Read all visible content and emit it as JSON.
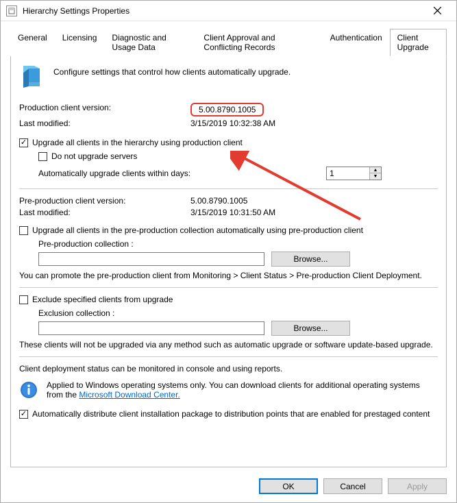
{
  "window": {
    "title": "Hierarchy Settings Properties"
  },
  "tabs": {
    "general": "General",
    "licensing": "Licensing",
    "diagnostic": "Diagnostic and Usage Data",
    "client_approval": "Client Approval and Conflicting Records",
    "authentication": "Authentication",
    "client_upgrade": "Client Upgrade"
  },
  "intro": "Configure settings that control how clients automatically upgrade.",
  "prod": {
    "version_label": "Production client version:",
    "version_value": "5.00.8790.1005",
    "modified_label": "Last modified:",
    "modified_value": "3/15/2019 10:32:38 AM"
  },
  "upgrade_hierarchy": "Upgrade all clients in the hierarchy using production client",
  "no_servers": "Do not upgrade servers",
  "auto_days_label": "Automatically upgrade clients within days:",
  "auto_days_value": "1",
  "preprod": {
    "version_label": "Pre-production client version:",
    "version_value": "5.00.8790.1005",
    "modified_label": "Last modified:",
    "modified_value": "3/15/2019 10:31:50 AM"
  },
  "upgrade_preprod": "Upgrade all clients in the pre-production collection automatically using pre-production client",
  "preprod_collection_label": "Pre-production collection :",
  "browse": "Browse...",
  "promote_note": "You can promote the pre-production client from Monitoring > Client Status > Pre-production Client Deployment.",
  "exclude": "Exclude specified clients from upgrade",
  "exclusion_label": "Exclusion collection :",
  "exclude_note": "These clients will not be upgraded via any method such as automatic upgrade or software update-based upgrade.",
  "deploy_status": "Client deployment status can be monitored in console and using reports.",
  "info_text_prefix": "Applied to Windows operating systems only. You can download clients for additional operating systems from the ",
  "info_link": "Microsoft Download Center.",
  "auto_distribute": "Automatically distribute client installation package to distribution points that are enabled for prestaged content",
  "buttons": {
    "ok": "OK",
    "cancel": "Cancel",
    "apply": "Apply"
  }
}
